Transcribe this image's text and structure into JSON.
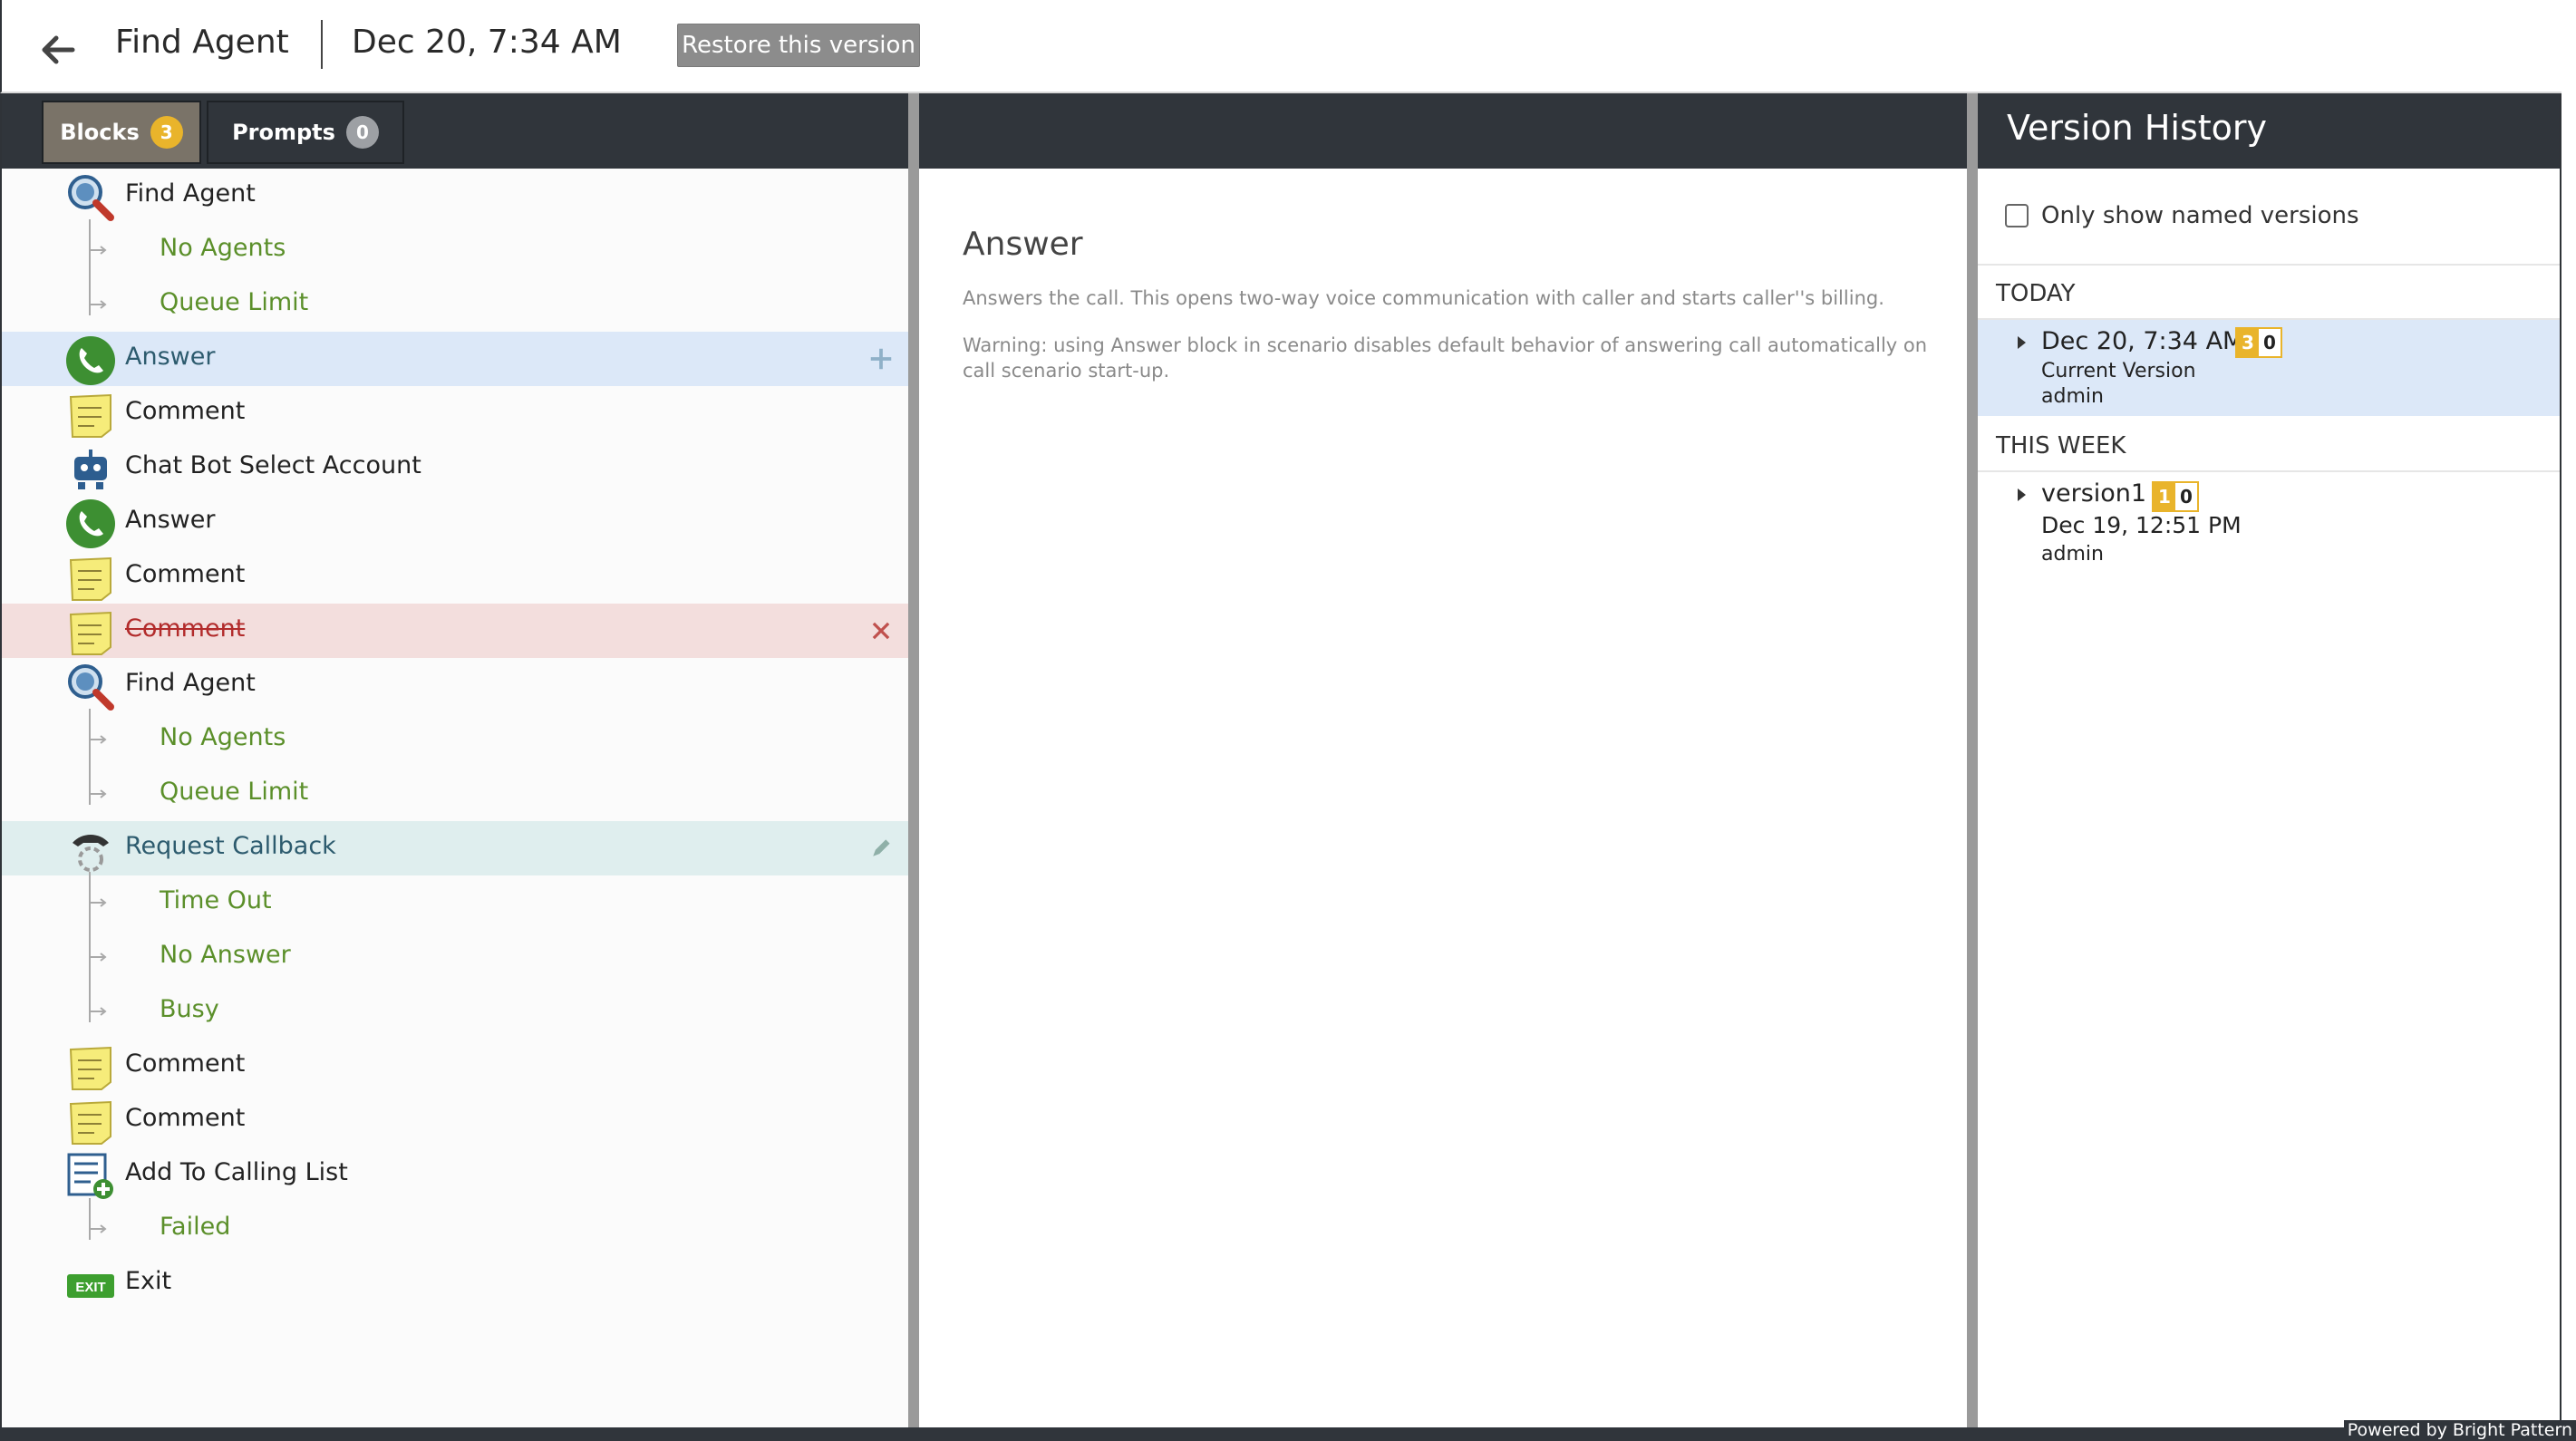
{
  "header": {
    "app_title": "Find Agent",
    "version_date": "Dec 20, 7:34 AM",
    "restore_label": "Restore this version"
  },
  "tabs": [
    {
      "label": "Blocks",
      "count": "3"
    },
    {
      "label": "Prompts",
      "count": "0"
    }
  ],
  "blocks": [
    {
      "label": "Find Agent",
      "icon": "find-agent-icon",
      "kind": "block"
    },
    {
      "label": "No Agents",
      "kind": "child"
    },
    {
      "label": "Queue Limit",
      "kind": "child"
    },
    {
      "label": "Answer",
      "icon": "phone-icon",
      "kind": "block",
      "state": "added"
    },
    {
      "label": "Comment",
      "icon": "note-icon",
      "kind": "block"
    },
    {
      "label": "Chat Bot Select Account",
      "icon": "robot-icon",
      "kind": "block"
    },
    {
      "label": "Answer",
      "icon": "phone-icon",
      "kind": "block"
    },
    {
      "label": "Comment",
      "icon": "note-icon",
      "kind": "block"
    },
    {
      "label": "Comment",
      "icon": "note-icon",
      "kind": "block",
      "state": "removed"
    },
    {
      "label": "Find Agent",
      "icon": "find-agent-icon",
      "kind": "block"
    },
    {
      "label": "No Agents",
      "kind": "child"
    },
    {
      "label": "Queue Limit",
      "kind": "child"
    },
    {
      "label": "Request Callback",
      "icon": "callback-icon",
      "kind": "block",
      "state": "modified"
    },
    {
      "label": "Time Out",
      "kind": "child"
    },
    {
      "label": "No Answer",
      "kind": "child"
    },
    {
      "label": "Busy",
      "kind": "child"
    },
    {
      "label": "Comment",
      "icon": "note-icon",
      "kind": "block"
    },
    {
      "label": "Comment",
      "icon": "note-icon",
      "kind": "block"
    },
    {
      "label": "Add To Calling List",
      "icon": "calling-list-icon",
      "kind": "block"
    },
    {
      "label": "Failed",
      "kind": "child"
    },
    {
      "label": "Exit",
      "icon": "exit-icon",
      "kind": "block"
    }
  ],
  "details": {
    "title": "Answer",
    "description": "Answers the call. This opens two-way voice communication with caller and starts caller''s billing.",
    "warning": "Warning: using Answer block in scenario disables default behavior of answering call automatically on call scenario start-up."
  },
  "version_history": {
    "title": "Version History",
    "named_only_label": "Only show named versions",
    "groups": [
      {
        "label": "TODAY",
        "versions": [
          {
            "name": "Dec 20, 7:34 AM",
            "badge_blocks": "3",
            "badge_prompts": "0",
            "sub1": "Current Version",
            "sub2": "admin"
          }
        ]
      },
      {
        "label": "THIS WEEK",
        "versions": [
          {
            "name": "version1",
            "badge_blocks": "1",
            "badge_prompts": "0",
            "sub1": "Dec 19, 12:51 PM",
            "sub2": "admin"
          }
        ]
      }
    ]
  },
  "footer": {
    "powered_by": "Powered by Bright Pattern"
  },
  "colors": {
    "dark_bar": "#30353b",
    "accent_yellow": "#e9b42b",
    "child_green": "#5b8f2a",
    "added_row": "#dce8f8",
    "removed_row": "#f3dedd",
    "modified_row": "#dfeeee"
  }
}
